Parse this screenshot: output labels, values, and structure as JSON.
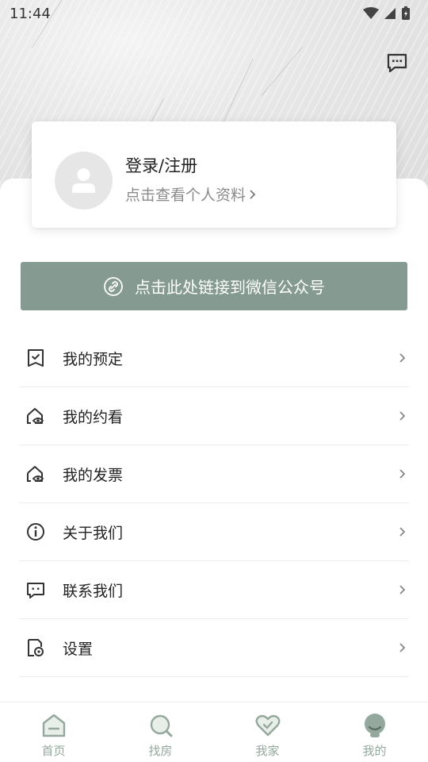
{
  "status_bar": {
    "time": "11:44"
  },
  "profile": {
    "title": "登录/注册",
    "subtitle": "点击查看个人资料"
  },
  "wechat_banner": {
    "label": "点击此处链接到微信公众号"
  },
  "menu": [
    {
      "label": "我的预定",
      "icon": "calendar-check-icon"
    },
    {
      "label": "我的约看",
      "icon": "house-eye-icon"
    },
    {
      "label": "我的发票",
      "icon": "house-eye-icon"
    },
    {
      "label": "关于我们",
      "icon": "info-circle-icon"
    },
    {
      "label": "联系我们",
      "icon": "chat-icon"
    },
    {
      "label": "设置",
      "icon": "settings-doc-icon"
    }
  ],
  "tabs": [
    {
      "label": "首页",
      "icon": "home-icon"
    },
    {
      "label": "找房",
      "icon": "search-icon"
    },
    {
      "label": "我家",
      "icon": "heart-check-icon"
    },
    {
      "label": "我的",
      "icon": "user-icon",
      "active": true
    }
  ],
  "colors": {
    "accent": "#859a91",
    "tab_color": "#94a89d",
    "text": "#222222",
    "muted": "#8b8b8b"
  }
}
